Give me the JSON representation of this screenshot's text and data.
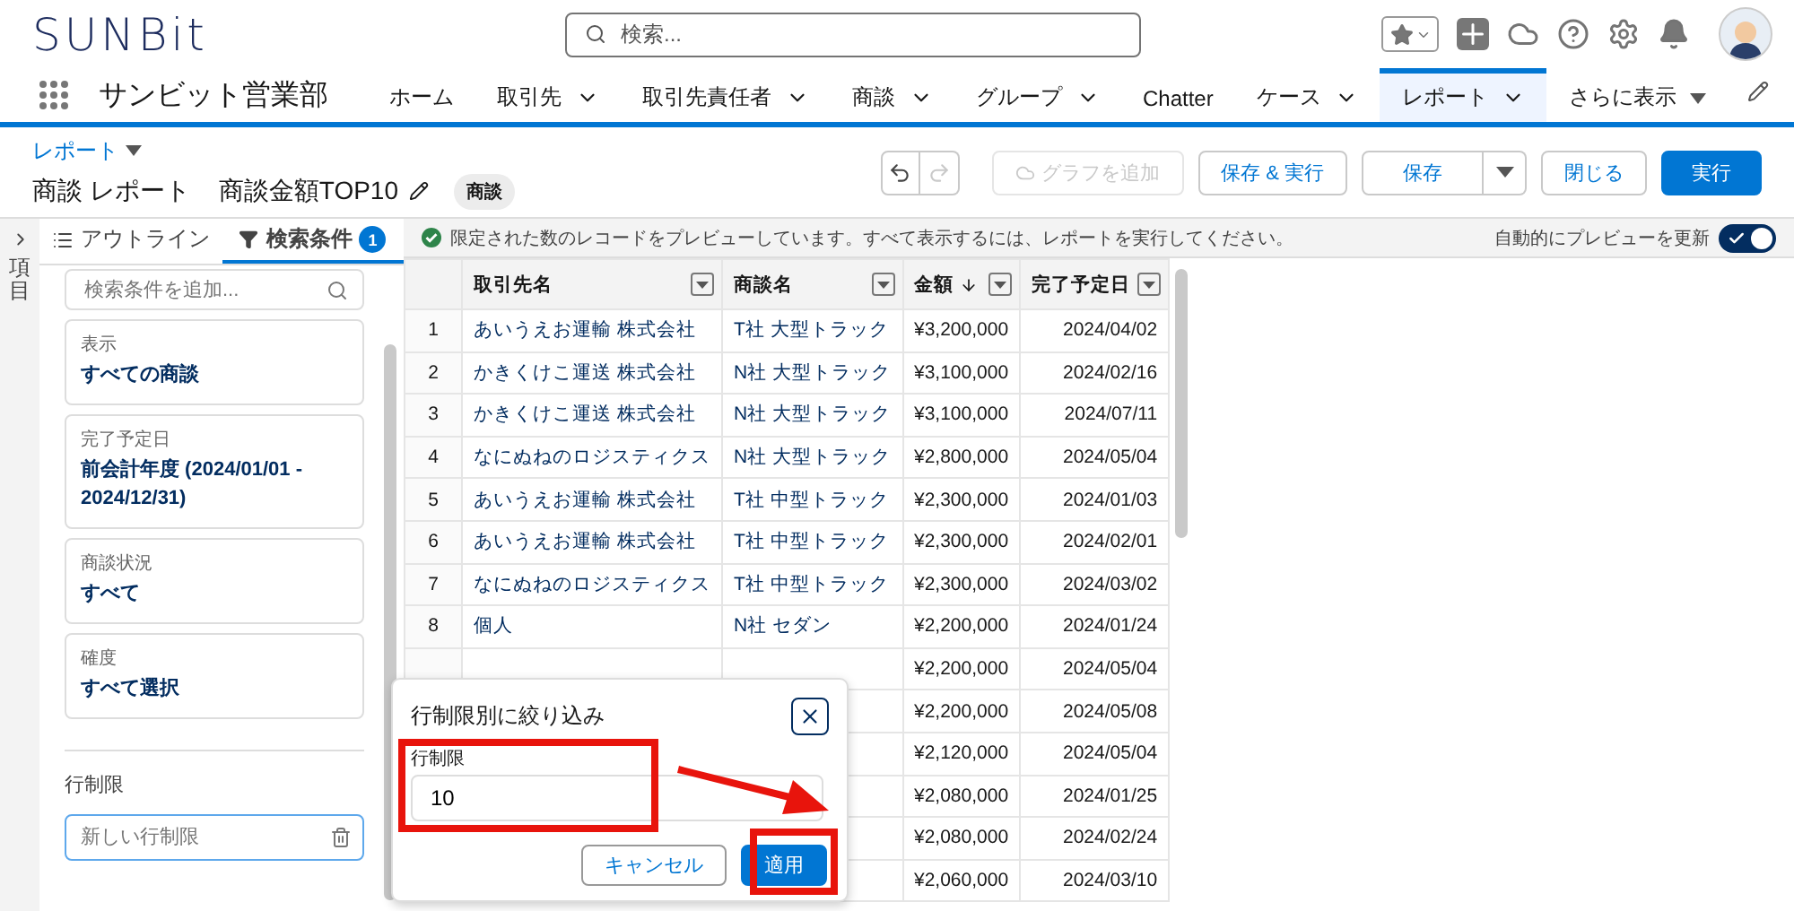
{
  "header": {
    "logo": "SUNBit",
    "search_placeholder": "検索..."
  },
  "nav": {
    "app_name": "サンビット営業部",
    "items": [
      {
        "label": "ホーム",
        "has_menu": false,
        "selected": false
      },
      {
        "label": "取引先",
        "has_menu": true,
        "selected": false
      },
      {
        "label": "取引先責任者",
        "has_menu": true,
        "selected": false
      },
      {
        "label": "商談",
        "has_menu": true,
        "selected": false
      },
      {
        "label": "グループ",
        "has_menu": true,
        "selected": false
      },
      {
        "label": "Chatter",
        "has_menu": false,
        "selected": false
      },
      {
        "label": "ケース",
        "has_menu": true,
        "selected": false
      },
      {
        "label": "レポート",
        "has_menu": true,
        "selected": true
      }
    ],
    "more": "さらに表示"
  },
  "report": {
    "breadcrumb": "レポート",
    "title": "商談 レポート",
    "name": "商談金額TOP10",
    "badge": "商談"
  },
  "toolbar": [
    {
      "kind": "undo",
      "disabled": false
    },
    {
      "kind": "redo",
      "disabled": true
    },
    {
      "kind": "button",
      "label": "グラフを追加",
      "disabled": true
    },
    {
      "kind": "button",
      "label": "保存 & 実行",
      "disabled": false
    },
    {
      "kind": "split",
      "label": "保存",
      "disabled": false
    },
    {
      "kind": "button",
      "label": "閉じる",
      "disabled": false
    },
    {
      "kind": "primary",
      "label": "実行",
      "disabled": false
    }
  ],
  "sidebar": {
    "label": "項目"
  },
  "panel": {
    "tabs": [
      {
        "label": "アウトライン",
        "selected": false
      },
      {
        "label": "検索条件",
        "selected": true,
        "count": "1"
      }
    ],
    "search_placeholder": "検索条件を追加...",
    "filters": [
      {
        "label": "表示",
        "value": "すべての商談"
      },
      {
        "label": "完了予定日",
        "value": "前会計年度 (2024/01/01 - 2024/12/31)"
      },
      {
        "label": "商談状況",
        "value": "すべて"
      },
      {
        "label": "確度",
        "value": "すべて選択"
      }
    ],
    "row_limit": {
      "heading": "行制限",
      "placeholder": "新しい行制限"
    }
  },
  "banner": {
    "text": "限定された数のレコードをプレビューしています。すべて表示するには、レポートを実行してください。",
    "toggle_label": "自動的にプレビューを更新",
    "toggle_on": true
  },
  "table": {
    "columns": [
      {
        "label": "取引先名",
        "sorted": false
      },
      {
        "label": "商談名",
        "sorted": false
      },
      {
        "label": "金額",
        "sorted": true
      },
      {
        "label": "完了予定日",
        "sorted": false
      }
    ],
    "rows": [
      {
        "num": "1",
        "account": "あいうえお運輸 株式会社",
        "deal": "T社 大型トラック",
        "amount": "¥3,200,000",
        "date": "2024/04/02"
      },
      {
        "num": "2",
        "account": "かきくけこ運送 株式会社",
        "deal": "N社 大型トラック",
        "amount": "¥3,100,000",
        "date": "2024/02/16"
      },
      {
        "num": "3",
        "account": "かきくけこ運送 株式会社",
        "deal": "N社 大型トラック",
        "amount": "¥3,100,000",
        "date": "2024/07/11"
      },
      {
        "num": "4",
        "account": "なにぬねのロジスティクス",
        "deal": "N社 大型トラック",
        "amount": "¥2,800,000",
        "date": "2024/05/04"
      },
      {
        "num": "5",
        "account": "あいうえお運輸 株式会社",
        "deal": "T社 中型トラック",
        "amount": "¥2,300,000",
        "date": "2024/01/03"
      },
      {
        "num": "6",
        "account": "あいうえお運輸 株式会社",
        "deal": "T社 中型トラック",
        "amount": "¥2,300,000",
        "date": "2024/02/01"
      },
      {
        "num": "7",
        "account": "なにぬねのロジスティクス",
        "deal": "T社 中型トラック",
        "amount": "¥2,300,000",
        "date": "2024/03/02"
      },
      {
        "num": "8",
        "account": "個人",
        "deal": "N社 セダン",
        "amount": "¥2,200,000",
        "date": "2024/01/24"
      },
      {
        "amount": "¥2,200,000",
        "date": "2024/05/04"
      },
      {
        "amount": "¥2,200,000",
        "date": "2024/05/08"
      },
      {
        "amount": "¥2,120,000",
        "date": "2024/05/04"
      },
      {
        "amount": "¥2,080,000",
        "date": "2024/01/25"
      },
      {
        "amount": "¥2,080,000",
        "date": "2024/02/24"
      },
      {
        "amount": "¥2,060,000",
        "date": "2024/03/10"
      }
    ]
  },
  "popover": {
    "title": "行制限別に絞り込み",
    "field_label": "行制限",
    "value": "10",
    "cancel": "キャンセル",
    "apply": "適用"
  }
}
